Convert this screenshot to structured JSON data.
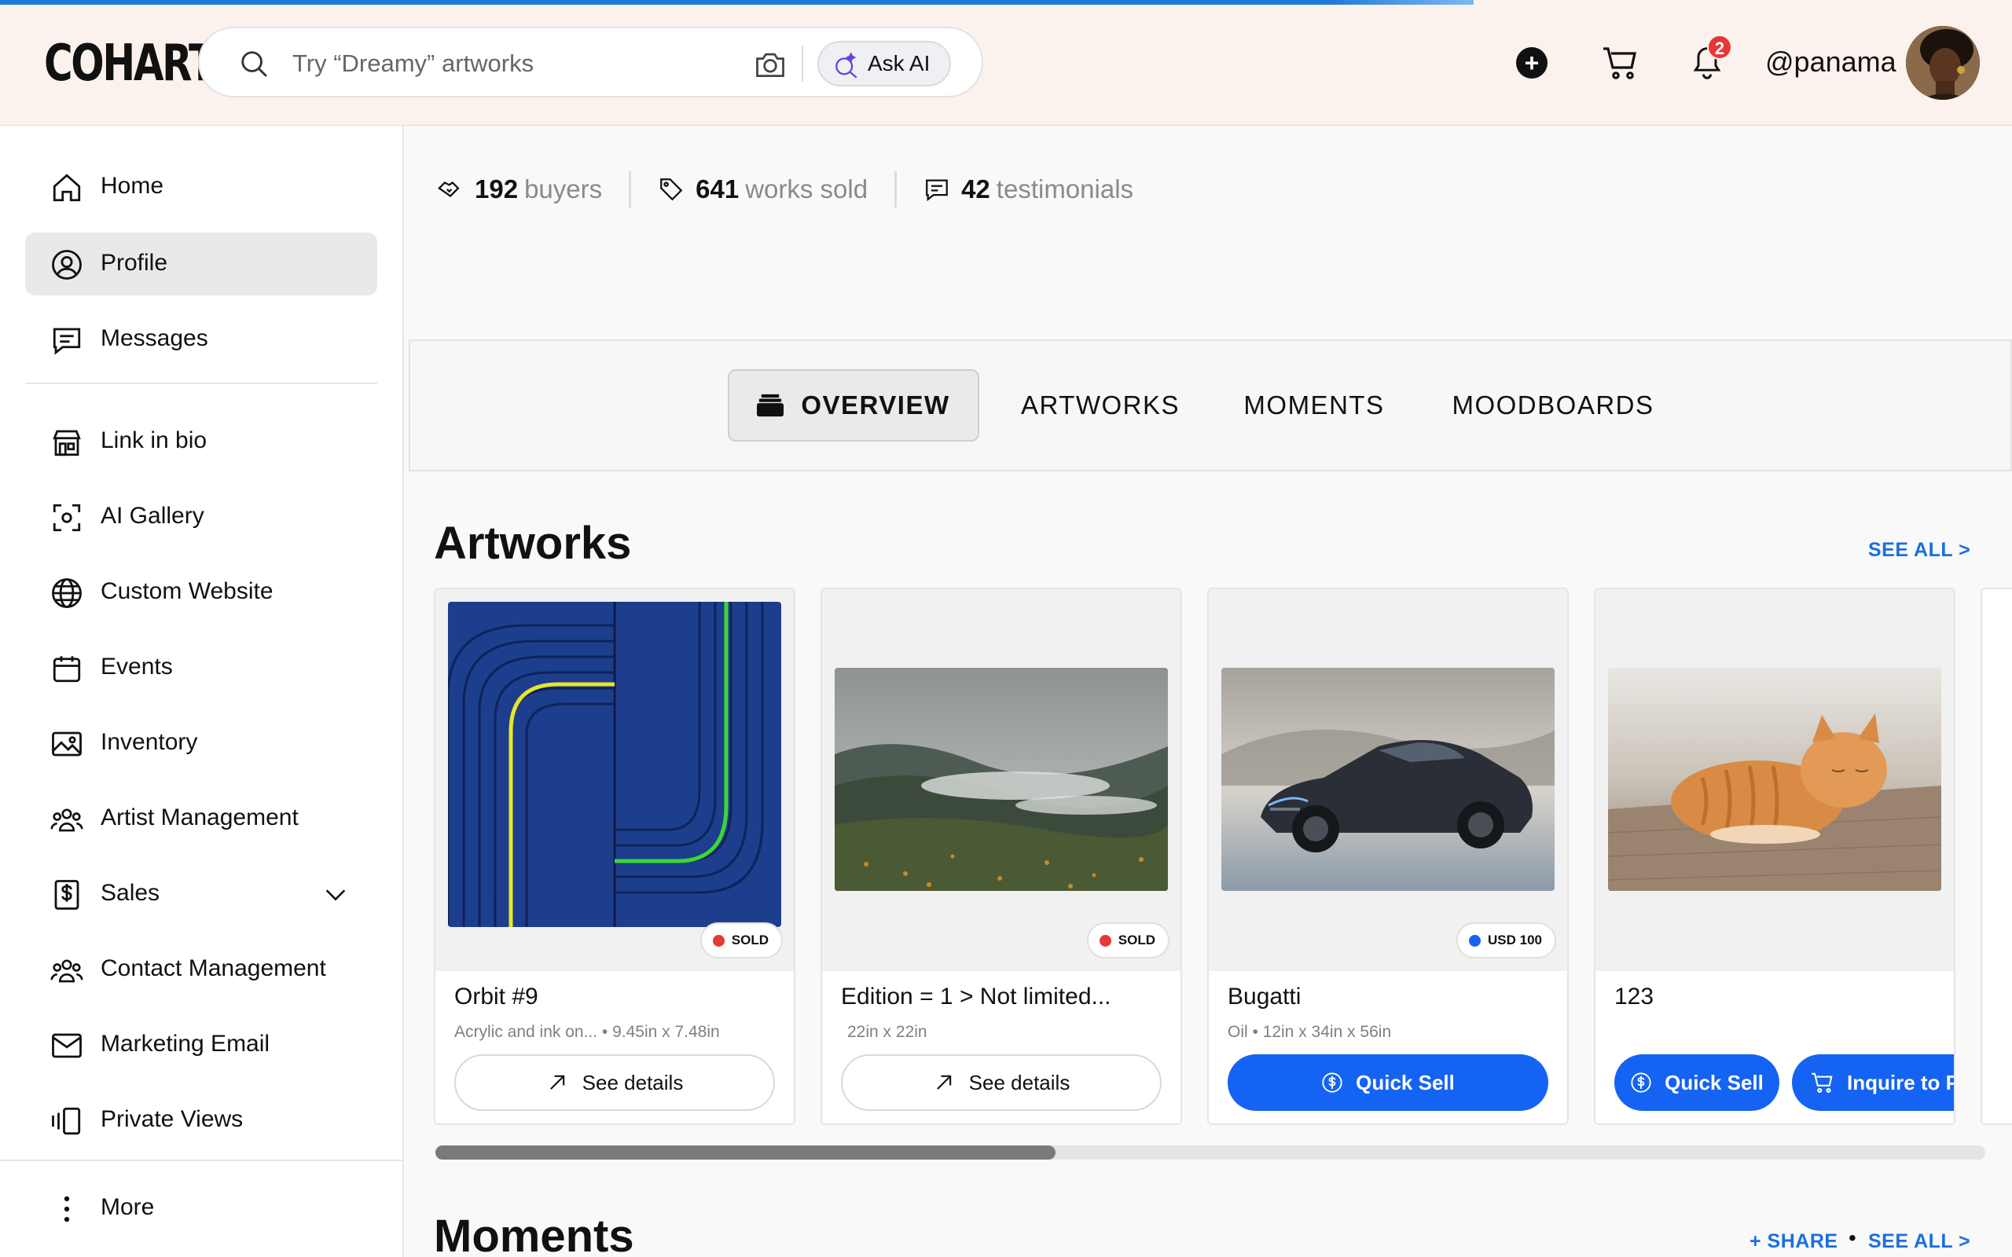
{
  "header": {
    "logo": "COHART",
    "search_placeholder": "Try “Dreamy” artworks",
    "ask_ai_label": "Ask AI",
    "notification_count": "2",
    "username": "@panama"
  },
  "sidebar": {
    "items": [
      {
        "label": "Home",
        "icon": "home-icon"
      },
      {
        "label": "Profile",
        "icon": "user-circle-icon",
        "active": true
      },
      {
        "label": "Messages",
        "icon": "chat-icon"
      },
      {
        "label": "Link in bio",
        "icon": "storefront-icon"
      },
      {
        "label": "AI Gallery",
        "icon": "scan-icon"
      },
      {
        "label": "Custom Website",
        "icon": "globe-icon"
      },
      {
        "label": "Events",
        "icon": "calendar-icon"
      },
      {
        "label": "Inventory",
        "icon": "image-icon"
      },
      {
        "label": "Artist Management",
        "icon": "group-icon"
      },
      {
        "label": "Sales",
        "icon": "dollar-doc-icon"
      },
      {
        "label": "Contact Management",
        "icon": "group-icon"
      },
      {
        "label": "Marketing Email",
        "icon": "mail-icon"
      },
      {
        "label": "Private Views",
        "icon": "slides-icon"
      }
    ],
    "more_label": "More"
  },
  "stats": [
    {
      "value": "192",
      "label": "buyers",
      "icon": "handshake-icon"
    },
    {
      "value": "641",
      "label": "works sold",
      "icon": "tag-icon"
    },
    {
      "value": "42",
      "label": "testimonials",
      "icon": "comment-icon"
    }
  ],
  "tabs": [
    {
      "label": "OVERVIEW",
      "active": true
    },
    {
      "label": "ARTWORKS"
    },
    {
      "label": "MOMENTS"
    },
    {
      "label": "MOODBOARDS"
    }
  ],
  "artworks": {
    "title": "Artworks",
    "see_all": "SEE ALL >",
    "cards": [
      {
        "title": "Orbit #9",
        "meta": "Acrylic and ink on...  •  9.45in x 7.48in",
        "tag": "SOLD",
        "tag_color": "#e53935",
        "button": "See details"
      },
      {
        "title": "Edition = 1 > Not limited...",
        "meta": "22in x 22in",
        "tag": "SOLD",
        "tag_color": "#e53935",
        "button": "See details"
      },
      {
        "title": "Bugatti",
        "meta": "Oil  •  12in x 34in x 56in",
        "tag": "USD 100",
        "tag_color": "#1463f3",
        "button": "Quick Sell"
      },
      {
        "title": "123",
        "meta": "",
        "button": "Quick Sell",
        "button2": "Inquire to P"
      }
    ],
    "scroll_fraction": 0.4
  },
  "moments": {
    "title": "Moments",
    "share": "+ SHARE",
    "see_all": "SEE ALL >"
  },
  "colors": {
    "accent": "#1463f3",
    "link": "#1a6fe0",
    "header_bg": "#fcf2ed",
    "sold": "#e53935"
  }
}
